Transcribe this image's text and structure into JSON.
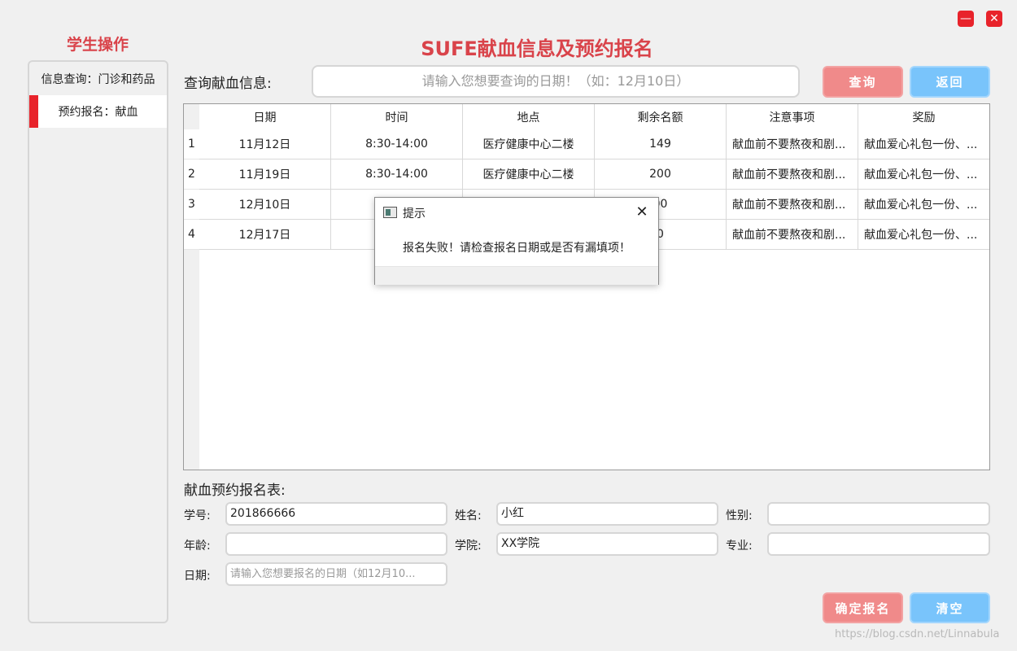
{
  "window": {
    "minimize_icon": "minimize-icon",
    "close_icon": "close-icon",
    "minimize_glyph": "—",
    "close_glyph": "✕"
  },
  "sidebar": {
    "title": "学生操作",
    "items": [
      {
        "label": "信息查询：门诊和药品",
        "active": false
      },
      {
        "label": "预约报名：献血",
        "active": true
      }
    ]
  },
  "header": {
    "title": "SUFE献血信息及预约报名",
    "query_label": "查询献血信息:",
    "query_placeholder": "请输入您想要查询的日期！（如：12月10日）",
    "query_button": "查询",
    "back_button": "返回"
  },
  "table": {
    "columns": [
      "日期",
      "时间",
      "地点",
      "剩余名额",
      "注意事项",
      "奖励"
    ],
    "rows": [
      {
        "index": "1",
        "cells": [
          "11月12日",
          "8:30-14:00",
          "医疗健康中心二楼",
          "149",
          "献血前不要熬夜和剧...",
          "献血爱心礼包一份、..."
        ]
      },
      {
        "index": "2",
        "cells": [
          "11月19日",
          "8:30-14:00",
          "医疗健康中心二楼",
          "200",
          "献血前不要熬夜和剧...",
          "献血爱心礼包一份、..."
        ]
      },
      {
        "index": "3",
        "cells": [
          "12月10日",
          "8:",
          "",
          "00",
          "献血前不要熬夜和剧...",
          "献血爱心礼包一份、..."
        ]
      },
      {
        "index": "4",
        "cells": [
          "12月17日",
          "8:",
          "",
          "0",
          "献血前不要熬夜和剧...",
          "献血爱心礼包一份、..."
        ]
      }
    ]
  },
  "form": {
    "title": "献血预约报名表:",
    "student_id_label": "学号:",
    "student_id_value": "201866666",
    "name_label": "姓名:",
    "name_value": "小红",
    "gender_label": "性别:",
    "gender_value": "",
    "age_label": "年龄:",
    "age_value": "",
    "college_label": "学院:",
    "college_value": "XX学院",
    "major_label": "专业:",
    "major_value": "",
    "date_label": "日期:",
    "date_placeholder": "请输入您想要报名的日期（如12月10...",
    "submit_button": "确定报名",
    "clear_button": "清空"
  },
  "dialog": {
    "title": "提示",
    "message": "报名失败！请检查报名日期或是否有漏填项！",
    "close_glyph": "✕"
  },
  "watermark": "https://blog.csdn.net/Linnabula",
  "colors": {
    "accent_red": "#d9434a",
    "button_red": "#f08a8a",
    "button_blue": "#79c4fb",
    "active_marker": "#e8232b"
  }
}
